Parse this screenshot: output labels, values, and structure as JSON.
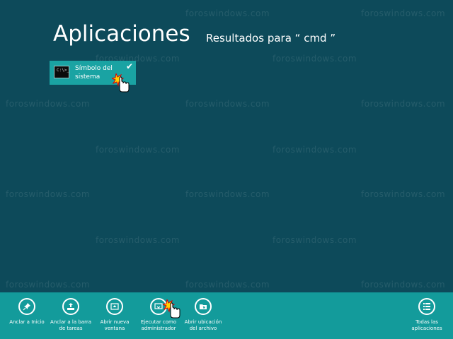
{
  "watermark": "foroswindows.com",
  "page_title": "Aplicaciones",
  "results_label": "Resultados para “ cmd ”",
  "app_result": {
    "icon_text": "C:\\>_",
    "line1": "Símbolo del",
    "line2": "sistema",
    "check": "✔"
  },
  "app_bar": {
    "pin_start": "Anclar a Inicio",
    "pin_taskbar_1": "Anclar a la barra",
    "pin_taskbar_2": "de tareas",
    "new_window_1": "Abrir nueva",
    "new_window_2": "ventana",
    "run_admin_1": "Ejecutar como",
    "run_admin_2": "administrador",
    "open_location_1": "Abrir ubicación",
    "open_location_2": "del archivo",
    "all_apps_1": "Todas las",
    "all_apps_2": "aplicaciones"
  },
  "colors": {
    "background": "#0d4a5a",
    "tile": "#1aa3a3",
    "app_bar": "#139b9b"
  }
}
